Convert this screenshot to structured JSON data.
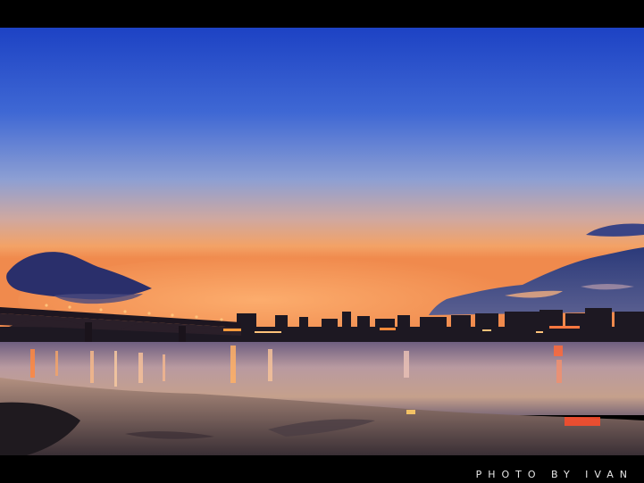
{
  "photo": {
    "credit": "PHOTO BY IVAN"
  },
  "colors": {
    "frame": "#000000",
    "sky_top": "#1f47c8",
    "sky_mid": "#8da1d8",
    "sky_horizon": "#f3a163",
    "water": "#c39a86",
    "light_glow": "#ff9a3c",
    "cloud": "#2c3a73"
  }
}
